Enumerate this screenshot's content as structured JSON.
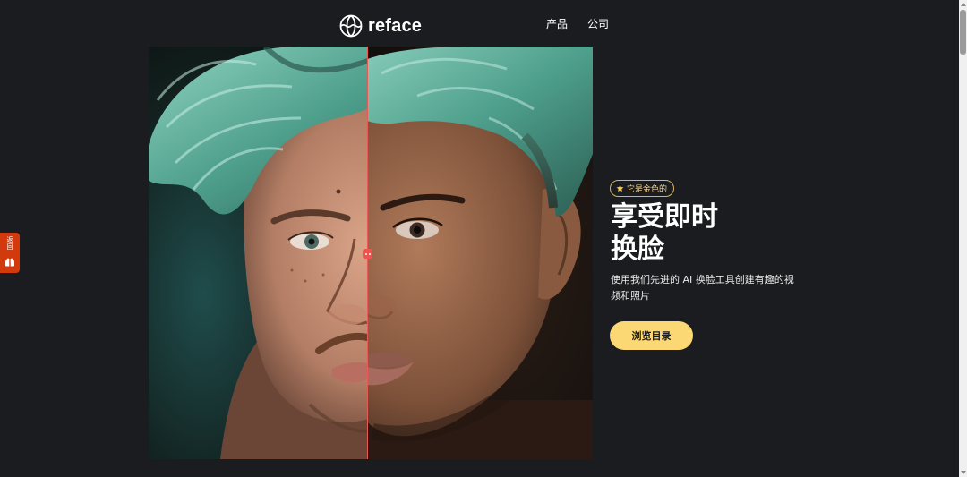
{
  "header": {
    "logo_text": "reface",
    "logo_icon": "reface-globe-icon",
    "nav": [
      {
        "label": "产品"
      },
      {
        "label": "公司"
      }
    ]
  },
  "hero": {
    "image": "face-swap-split-portrait",
    "split_handle_icon": "drag-handle-icon",
    "split_position": 0.49,
    "badge": {
      "icon": "star-icon",
      "text": "它是金色的"
    },
    "title_line1": "享受即时",
    "title_line2": "换脸",
    "subtitle": "使用我们先进的 AI 换脸工具创建有趣的视频和照片",
    "cta_label": "浏览目录"
  },
  "side_tab": {
    "text": "返回",
    "icon": "gift-icon"
  },
  "colors": {
    "background": "#1b1c1f",
    "accent": "#fcd874",
    "badge_border": "#d8b45f",
    "split_line": "#e85a55",
    "side_tab": "#d23a0e"
  }
}
